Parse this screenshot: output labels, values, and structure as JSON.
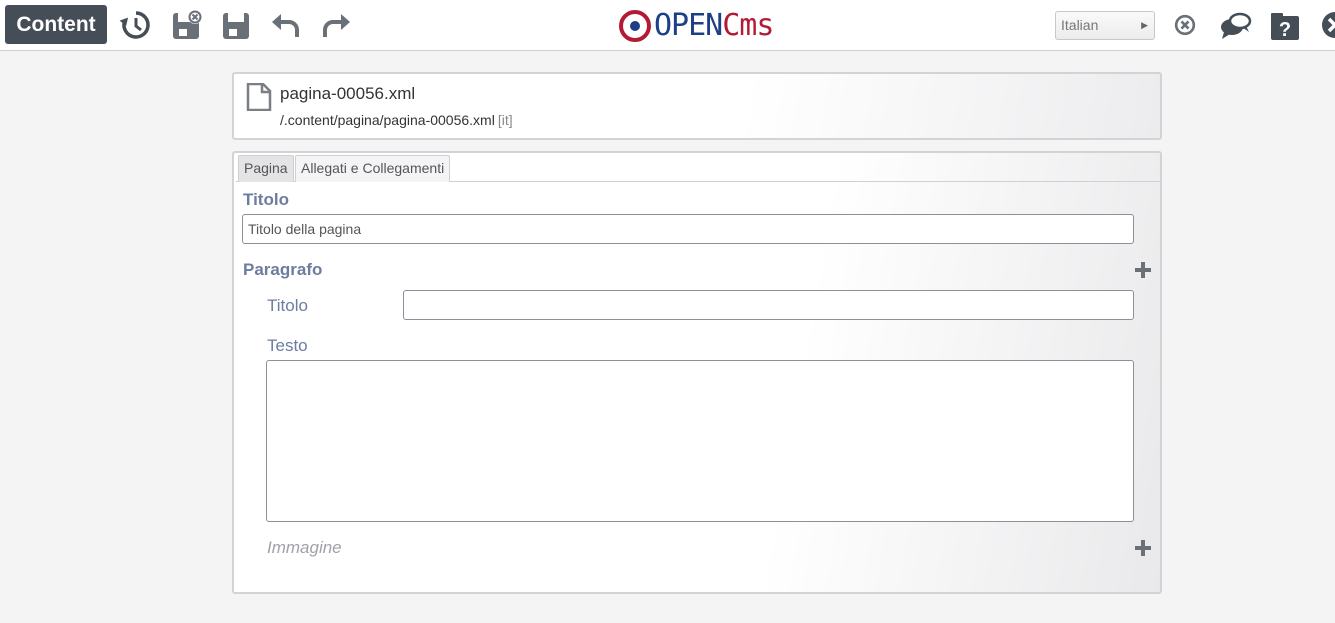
{
  "toolbar": {
    "context_label": "Content",
    "language": "Italian",
    "icons": [
      "history-icon",
      "save-and-exit-icon",
      "save-icon",
      "undo-icon",
      "redo-icon",
      "cancel-icon",
      "comment-icon",
      "help-icon",
      "close-icon"
    ]
  },
  "logo": {
    "part1": "OpenCms",
    "open": "OPEN",
    "cms": "Cms"
  },
  "resource": {
    "name": "pagina-00056.xml",
    "path": "/.content/pagina/pagina-00056.xml",
    "locale": "[it]"
  },
  "tabs": [
    {
      "label": "Pagina"
    },
    {
      "label": "Allegati e Collegamenti"
    }
  ],
  "form": {
    "title_label": "Titolo",
    "title_value": "Titolo della pagina",
    "paragraph_label": "Paragrafo",
    "paragraph_title_label": "Titolo",
    "paragraph_title_value": "",
    "text_label": "Testo",
    "text_value": "",
    "image_label": "Immagine"
  },
  "colors": {
    "toolbar_button": "#454d56",
    "label": "#6d7d9f",
    "logo_blue": "#1c3f86",
    "logo_red": "#b31b34"
  }
}
